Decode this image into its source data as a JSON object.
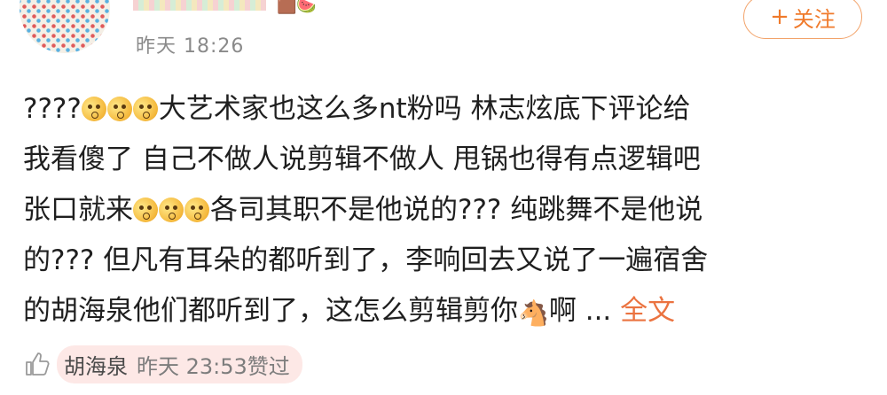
{
  "comment": {
    "timestamp": "昨天 18:26",
    "follow_label": "关注",
    "lines": [
      [
        "????",
        "大艺术家也这么多nt粉吗 林志炫底下评论给"
      ],
      [
        "我看傻了 自己不做人说剪辑不做人 甩锅也得有点逻辑吧"
      ],
      [
        "张口就来",
        "各司其职不是他说的??? 纯跳舞不是他说"
      ],
      [
        "的??? 但凡有耳朵的都听到了，李响回去又说了一遍宿舍"
      ],
      [
        "的胡海泉他们都听到了，这怎么剪辑剪你",
        "啊",
        " ...",
        "全文"
      ]
    ]
  },
  "footer": {
    "liker": "胡海泉",
    "time": "昨天 23:53",
    "action": "赞过"
  },
  "colors": {
    "accent": "#f07a2b",
    "text": "#1f1f1f",
    "muted": "#8a8a8a"
  }
}
